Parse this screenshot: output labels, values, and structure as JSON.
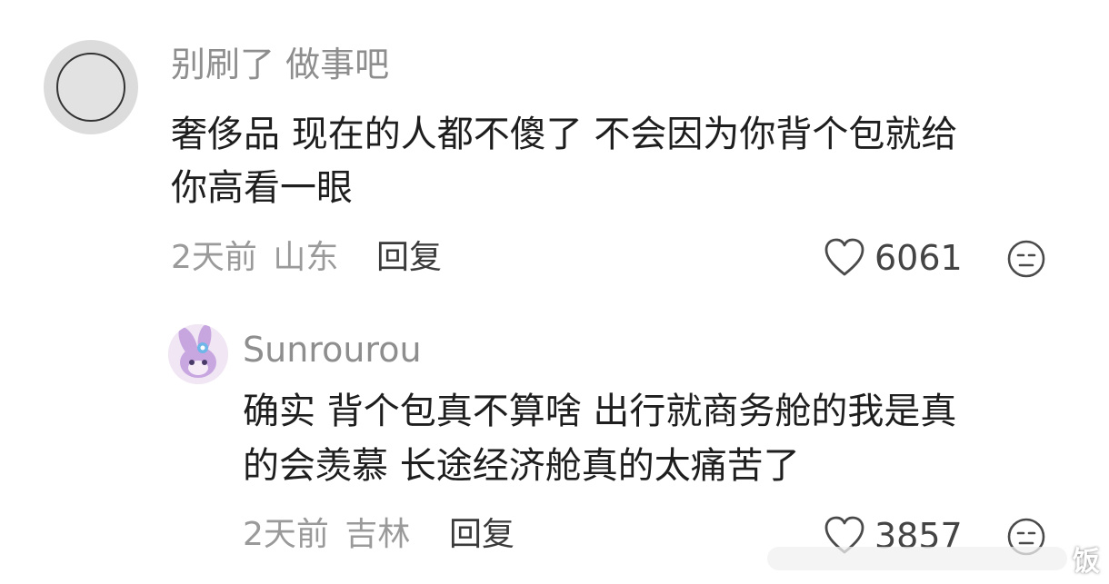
{
  "comment": {
    "username": "别刷了 做事吧",
    "text_line1": "奢侈品 现在的人都不傻了 不会因为你背个包就给",
    "text_line2": "你高看一眼",
    "time": "2天前",
    "location": "山东",
    "reply_label": "回复",
    "likes": "6061"
  },
  "reply": {
    "username": "Sunrourou",
    "text_line1": "确实 背个包真不算啥 出行就商务舱的我是真",
    "text_line2": "的会羡慕 长途经济舱真的太痛苦了",
    "time": "2天前",
    "location": "吉林",
    "reply_label": "回复",
    "likes": "3857"
  },
  "watermark": {
    "text": "饭"
  },
  "icons": {
    "like": "heart-outline-icon",
    "dislike": "neutral-face-icon"
  },
  "colors": {
    "username": "#8e8e8e",
    "text": "#1e1e1e",
    "meta": "#9a9a9a",
    "avatar_bg": "#dcdcdc"
  }
}
